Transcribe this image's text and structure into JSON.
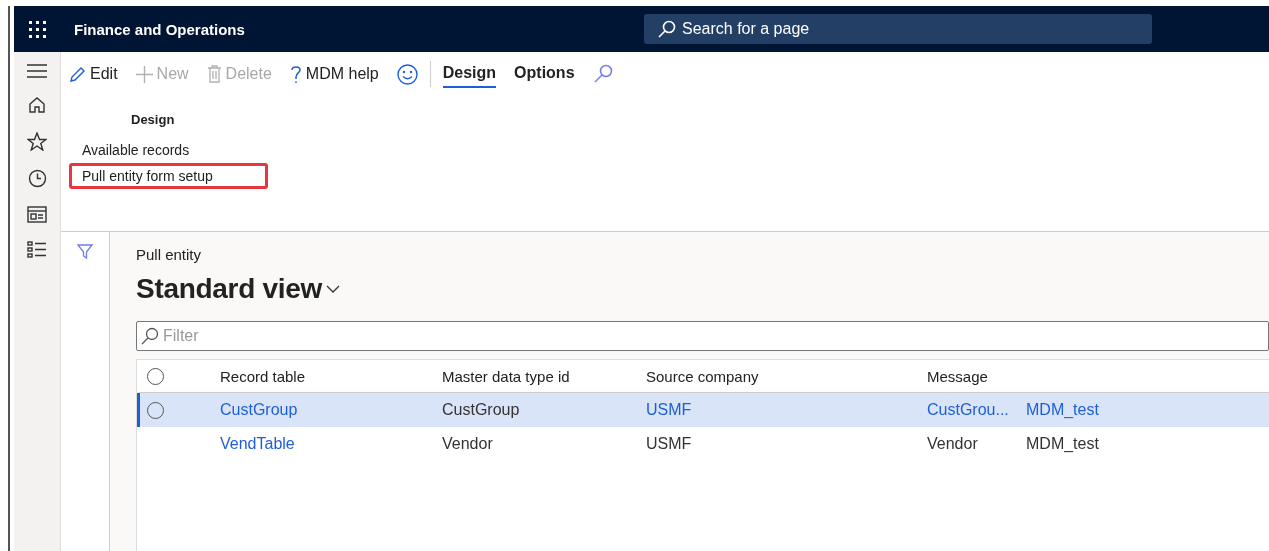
{
  "header": {
    "title": "Finance and Operations",
    "search": {
      "placeholder": "Search for a page"
    }
  },
  "toolbar": [
    {
      "kind": "edit",
      "label": "Edit",
      "disabled": false
    },
    {
      "kind": "new",
      "label": "New",
      "disabled": true
    },
    {
      "kind": "delete",
      "label": "Delete",
      "disabled": true
    },
    {
      "kind": "help",
      "label": "MDM help",
      "disabled": false
    },
    {
      "kind": "smiley",
      "disabled": false
    },
    {
      "kind": "tab",
      "label": "Design",
      "selected": true
    },
    {
      "kind": "tab",
      "label": "Options",
      "selected": false
    },
    {
      "kind": "search",
      "disabled": false
    }
  ],
  "ribbon": {
    "group_title": "Design",
    "items": [
      {
        "label": "Available records",
        "highlighted": false
      },
      {
        "label": "Pull entity form setup",
        "highlighted": true
      }
    ]
  },
  "page": {
    "caption": "Pull entity",
    "view": "Standard view",
    "filter": {
      "placeholder": "Filter"
    }
  },
  "table": {
    "all_selected": false,
    "columns": [
      "Record table",
      "Master data type id",
      "Source company",
      "Message"
    ],
    "rows": [
      {
        "selected": true,
        "cells": [
          {
            "text": "CustGroup",
            "link": true
          },
          {
            "text": "CustGroup",
            "link": false
          },
          {
            "text": "USMF",
            "link": true
          },
          {
            "text": "CustGrou...",
            "link": true
          },
          {
            "text": "MDM_test",
            "link": true
          }
        ]
      },
      {
        "selected": false,
        "cells": [
          {
            "text": "VendTable",
            "link": true
          },
          {
            "text": "Vendor",
            "link": false
          },
          {
            "text": "USMF",
            "link": false
          },
          {
            "text": "Vendor",
            "link": false
          },
          {
            "text": "MDM_test",
            "link": false
          }
        ]
      }
    ]
  }
}
